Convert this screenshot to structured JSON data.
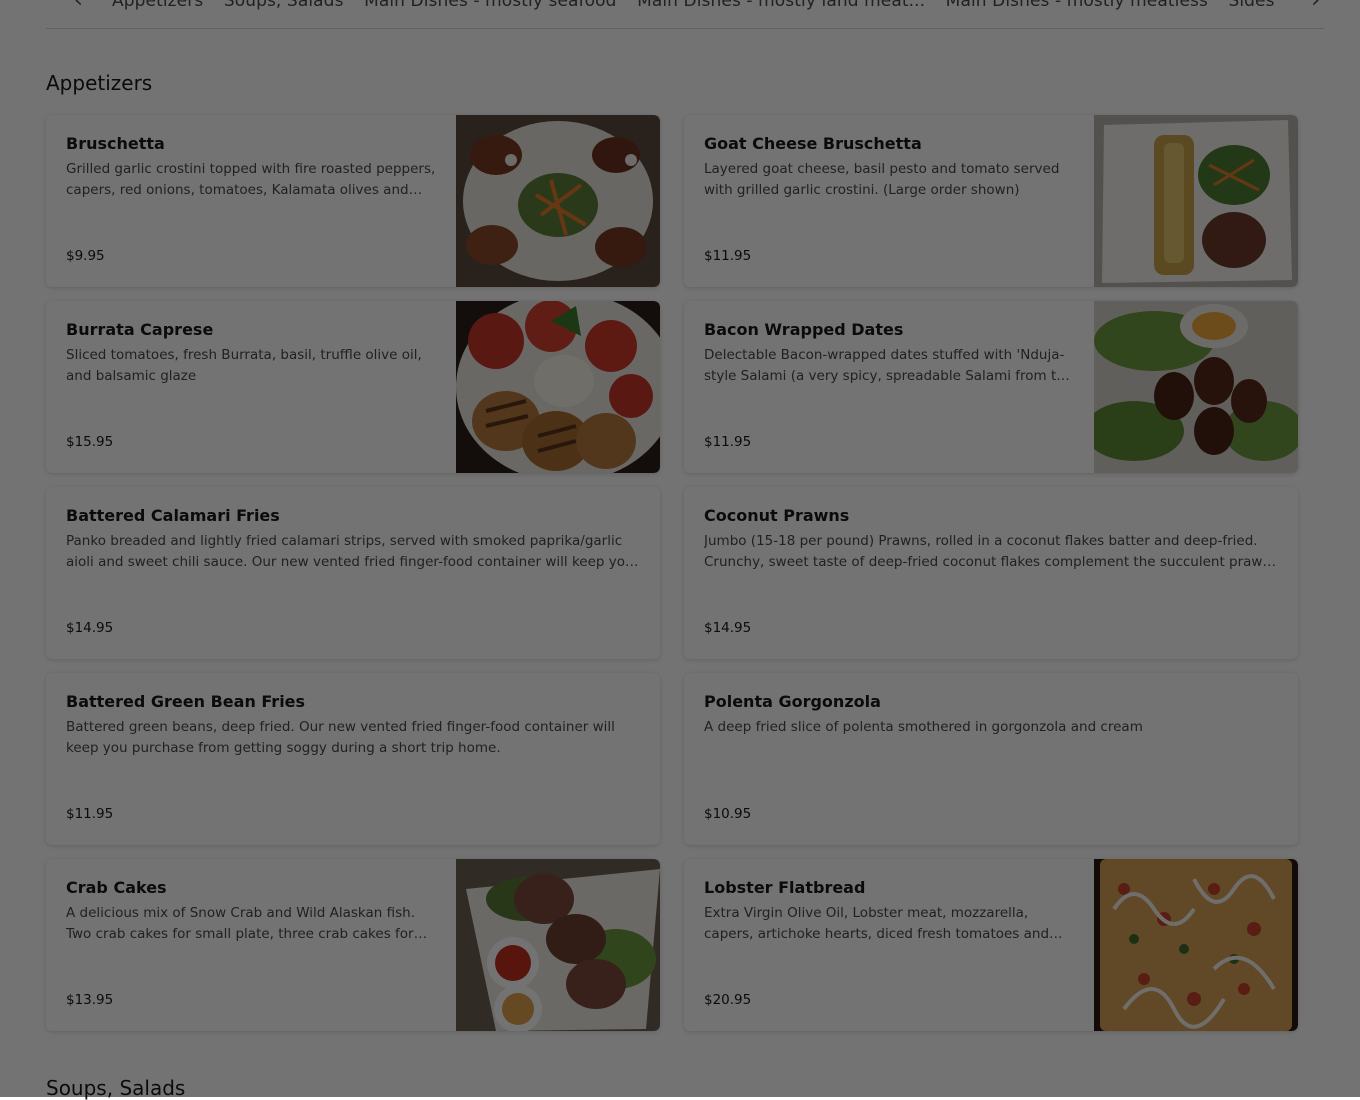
{
  "nav": {
    "prev_icon": "chevron-left-icon",
    "next_icon": "chevron-right-icon",
    "tabs": [
      "Appetizers",
      "Soups, Salads",
      "Main Dishes - mostly seafood",
      "Main Dishes - mostly land meat...",
      "Main Dishes - mostly meatless",
      "Sides"
    ]
  },
  "sections": {
    "appetizers": "Appetizers",
    "soups_salads": "Soups, Salads"
  },
  "items": [
    {
      "name": "Bruschetta",
      "desc": "Grilled garlic crostini topped with fire roasted peppers, capers, red onions, tomatoes, Kalamata olives and fresh basil.",
      "price": "$9.95"
    },
    {
      "name": "Goat Cheese Bruschetta",
      "desc": "Layered goat cheese, basil pesto and tomato served with grilled garlic crostini. (Large order shown)",
      "price": "$11.95"
    },
    {
      "name": "Burrata Caprese",
      "desc": "Sliced tomatoes, fresh Burrata, basil, truffle olive oil, and balsamic glaze",
      "price": "$15.95"
    },
    {
      "name": "Bacon Wrapped Dates",
      "desc": "Delectable Bacon-wrapped dates stuffed with 'Nduja-style Salami (a very spicy, spreadable Salami from the Calabria region).",
      "price": "$11.95"
    },
    {
      "name": "Battered Calamari Fries",
      "desc": "Panko breaded and lightly fried calamari strips, served with smoked paprika/garlic aioli and sweet chili sauce. Our new vented fried finger-food container will keep you purchase from getting soggy.",
      "price": "$14.95"
    },
    {
      "name": "Coconut Prawns",
      "desc": "Jumbo (15-18 per pound) Prawns, rolled in a coconut flakes batter and deep-fried. Crunchy, sweet taste of deep-fried coconut flakes complement the succulent prawn. Served with sauce.",
      "price": "$14.95"
    },
    {
      "name": "Battered Green Bean Fries",
      "desc": "Battered green beans, deep fried. Our new vented fried finger-food container will keep you purchase from getting soggy during a short trip home.",
      "price": "$11.95"
    },
    {
      "name": "Polenta Gorgonzola",
      "desc": "A deep fried slice of polenta smothered in gorgonzola and cream",
      "price": "$10.95"
    },
    {
      "name": "Crab Cakes",
      "desc": "A delicious mix of Snow Crab and Wild Alaskan fish. Two crab cakes for small plate, three crab cakes for large plate.",
      "price": "$13.95"
    },
    {
      "name": "Lobster Flatbread",
      "desc": "Extra Virgin Olive Oil, Lobster meat, mozzarella, capers, artichoke hearts, diced fresh tomatoes and basil, and aioli.",
      "price": "$20.95"
    }
  ]
}
